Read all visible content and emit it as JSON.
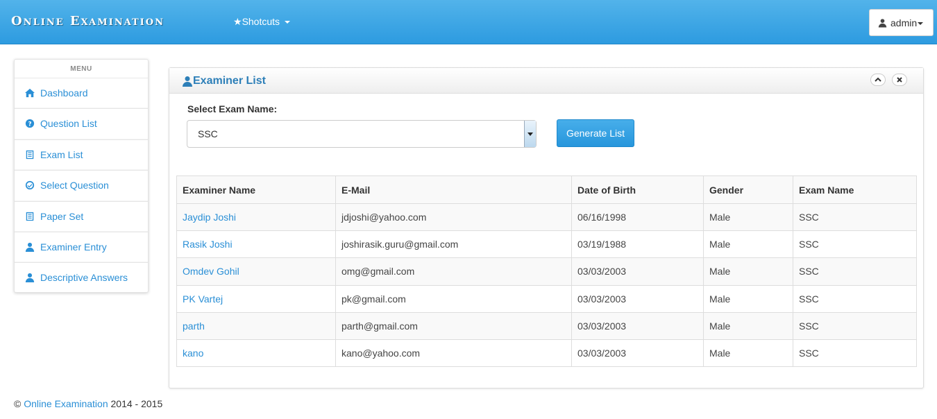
{
  "header": {
    "brand": "Online Examination",
    "shortcuts_label": "Shotcuts",
    "user_label": "admin"
  },
  "sidebar": {
    "title": "MENU",
    "items": [
      {
        "label": "Dashboard",
        "icon": "home-icon"
      },
      {
        "label": "Question List",
        "icon": "question-circle-icon"
      },
      {
        "label": "Exam List",
        "icon": "list-icon"
      },
      {
        "label": "Select Question",
        "icon": "check-circle-icon"
      },
      {
        "label": "Paper Set",
        "icon": "list-icon"
      },
      {
        "label": "Examiner Entry",
        "icon": "user-icon"
      },
      {
        "label": "Descriptive Answers",
        "icon": "user-icon"
      }
    ]
  },
  "panel": {
    "title": "Examiner List",
    "select_label": "Select Exam Name:",
    "select_value": "SSC",
    "generate_button": "Generate List"
  },
  "table": {
    "columns": [
      "Examiner Name",
      "E-Mail",
      "Date of Birth",
      "Gender",
      "Exam Name"
    ],
    "rows": [
      [
        "Jaydip Joshi",
        "jdjoshi@yahoo.com",
        "06/16/1998",
        "Male",
        "SSC"
      ],
      [
        "Rasik Joshi",
        "joshirasik.guru@gmail.com",
        "03/19/1988",
        "Male",
        "SSC"
      ],
      [
        "Omdev Gohil",
        "omg@gmail.com",
        "03/03/2003",
        "Male",
        "SSC"
      ],
      [
        "PK Vartej",
        "pk@gmail.com",
        "03/03/2003",
        "Male",
        "SSC"
      ],
      [
        "parth",
        "parth@gmail.com",
        "03/03/2003",
        "Male",
        "SSC"
      ],
      [
        "kano",
        "kano@yahoo.com",
        "03/03/2003",
        "Male",
        "SSC"
      ]
    ]
  },
  "footer": {
    "copyright": "©",
    "link_text": "Online Examination",
    "years": "2014 - 2015"
  }
}
